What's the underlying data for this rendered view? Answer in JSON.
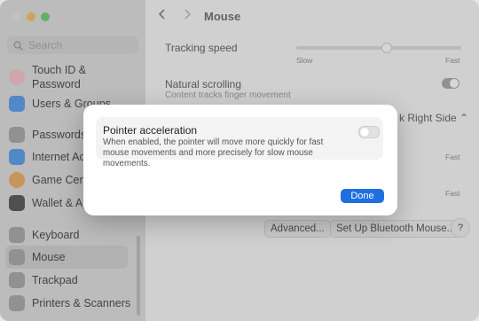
{
  "sidebar": {
    "search_placeholder": "Search",
    "items": [
      {
        "label_line1": "Touch ID &",
        "label_line2": "Password",
        "icon": "fingerprint-icon",
        "color": "#f4b9c0"
      },
      {
        "label": "Users & Groups",
        "icon": "users-icon",
        "color": "#3a8ee6"
      },
      {
        "label": "Passwords",
        "icon": "key-icon",
        "color": "#9a9a9a"
      },
      {
        "label": "Internet Accounts",
        "icon": "at-icon",
        "color": "#3a8ee6"
      },
      {
        "label": "Game Center",
        "icon": "game-center-icon",
        "color": "#e9a04a"
      },
      {
        "label": "Wallet & Apple Pay",
        "icon": "wallet-icon",
        "color": "#3a3a3a"
      },
      {
        "label": "Keyboard",
        "icon": "keyboard-icon",
        "color": "#9a9a9a"
      },
      {
        "label": "Mouse",
        "icon": "mouse-icon",
        "color": "#9a9a9a"
      },
      {
        "label": "Trackpad",
        "icon": "trackpad-icon",
        "color": "#9a9a9a"
      },
      {
        "label": "Printers & Scanners",
        "icon": "printer-icon",
        "color": "#9a9a9a"
      }
    ]
  },
  "header": {
    "title": "Mouse",
    "back_icon": "chevron-left-icon",
    "forward_icon": "chevron-right-icon"
  },
  "settings": {
    "tracking_speed": {
      "label": "Tracking speed",
      "min_label": "Slow",
      "max_label": "Fast",
      "value": 0.55
    },
    "natural_scrolling": {
      "label": "Natural scrolling",
      "sub": "Content tracks finger movement",
      "on": true
    },
    "secondary_click_value": "k Right Side",
    "fast_label_2": "Fast",
    "fast_label_3": "Fast"
  },
  "bottom_buttons": {
    "advanced": "Advanced...",
    "bluetooth": "Set Up Bluetooth Mouse...",
    "help": "?"
  },
  "dialog": {
    "title": "Pointer acceleration",
    "description": "When enabled, the pointer will move more quickly for fast mouse movements and more precisely for slow mouse movements.",
    "toggle_on": false,
    "done_label": "Done",
    "accent": "#1f6fe0"
  }
}
